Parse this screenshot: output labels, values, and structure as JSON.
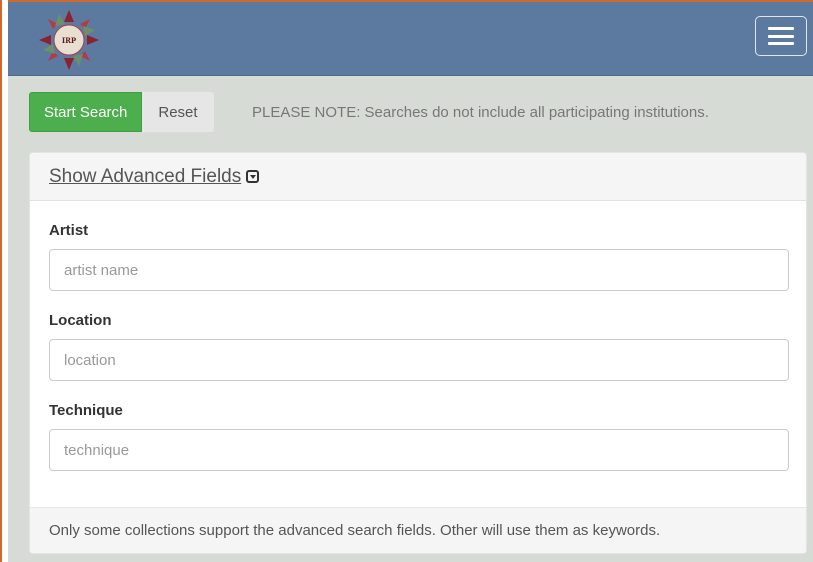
{
  "header": {
    "logo_icon": "irp-star-logo-icon",
    "logo_text": "IRP",
    "menu_icon": "hamburger-menu-icon"
  },
  "toolbar": {
    "start_label": "Start Search",
    "reset_label": "Reset",
    "note": "PLEASE NOTE: Searches do not include all participating institutions."
  },
  "panel": {
    "toggle_label": "Show Advanced Fields",
    "toggle_icon": "caret-square-down-icon",
    "fields": [
      {
        "label": "Artist",
        "placeholder": "artist name",
        "value": ""
      },
      {
        "label": "Location",
        "placeholder": "location",
        "value": ""
      },
      {
        "label": "Technique",
        "placeholder": "technique",
        "value": ""
      }
    ],
    "footer_note": "Only some collections support the advanced search fields. Other will use them as keywords."
  },
  "colors": {
    "navbar": "#5c7a9f",
    "accent_border": "#cf6a2c",
    "start_button": "#4cae4c",
    "background": "#d7dbd5"
  }
}
